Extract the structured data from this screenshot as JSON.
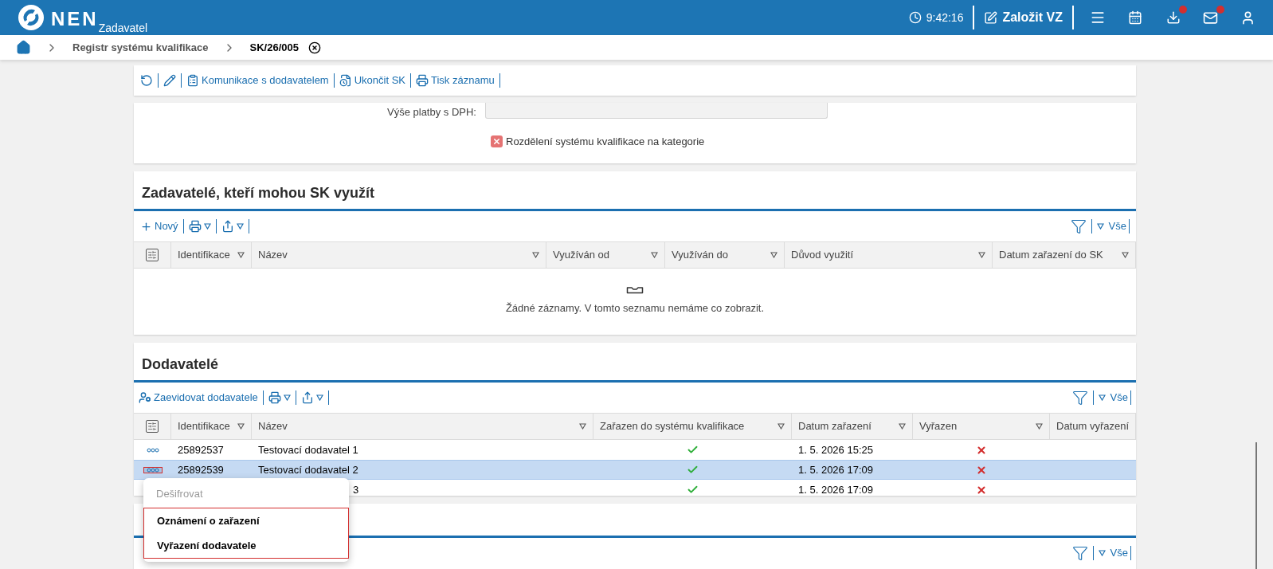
{
  "header": {
    "logo": "NEN",
    "role": "Zadavatel",
    "time": "9:42:16",
    "create_button": "Založit VZ",
    "download_badge": true,
    "mail_badge": true
  },
  "breadcrumb": [
    "Registr systému kvalifikace",
    "SK/26/005"
  ],
  "toolbar": [
    "Komunikace s dodavatelem",
    "Ukončit SK",
    "Tisk záznamu"
  ],
  "form": {
    "field_label": "Výše platby s DPH:",
    "checkbox_label": "Rozdělení systému kvalifikace na kategorie",
    "enabled": false
  },
  "users_section": {
    "title": "Zadavatelé, kteří mohou SK využít",
    "new_button": "Nový",
    "filter_all": "Vše",
    "columns": [
      "Identifikace",
      "Název",
      "Využíván od",
      "Využíván do",
      "Důvod využití",
      "Datum zařazení do SK"
    ],
    "empty_message": "Žádné záznamy. V tomto seznamu nemáme co zobrazit."
  },
  "suppliers_section": {
    "title": "Dodavatelé",
    "add_button": "Zaevidovat dodavatele",
    "filter_all": "Vše",
    "columns": [
      "Identifikace",
      "Název",
      "Zařazen do systému kvalifikace",
      "Datum zařazení",
      "Vyřazen",
      "Datum vyřazení"
    ],
    "rows": [
      {
        "kind": "full",
        "id": "25892537",
        "name": "Testovací dodavatel 1",
        "included": true,
        "date": "1. 5. 2026 15:25",
        "excluded": false,
        "selected": false
      },
      {
        "kind": "full",
        "id": "25892539",
        "name": "Testovací dodavatel 2",
        "included": true,
        "date": "1. 5. 2026 17:09",
        "excluded": false,
        "selected": true
      },
      {
        "kind": "covered",
        "name": "3",
        "included": true,
        "date": "1. 5. 2026 17:09",
        "excluded": false,
        "selected": false
      }
    ],
    "context_menu": {
      "focused": true,
      "items": [
        {
          "label": "Dešifrovat",
          "disabled": true
        },
        {
          "label": "Oznámení o zařazení",
          "disabled": false
        },
        {
          "label": "Vyřazení dodavatele",
          "disabled": false
        }
      ]
    }
  },
  "third_section": {
    "filter_all": "Vše"
  }
}
